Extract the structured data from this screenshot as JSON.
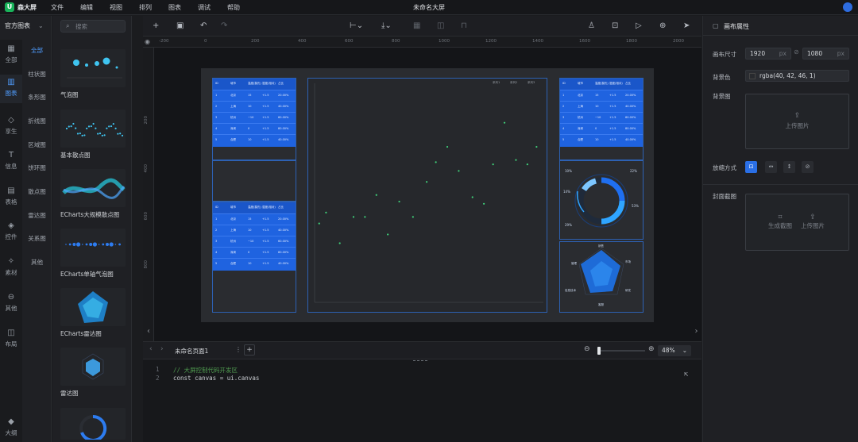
{
  "app": {
    "brand": "森大屏",
    "doc_title": "未命名大屏"
  },
  "menu": [
    "文件",
    "编辑",
    "视图",
    "排列",
    "图表",
    "调试",
    "帮助"
  ],
  "left": {
    "header": "官方图表",
    "rail": [
      {
        "label": "全部",
        "icon": "grid-icon"
      },
      {
        "label": "图表",
        "icon": "bar-chart-icon"
      },
      {
        "label": "享生",
        "icon": "diamond-icon"
      },
      {
        "label": "信息",
        "icon": "text-icon"
      },
      {
        "label": "表格",
        "icon": "table-icon"
      },
      {
        "label": "控件",
        "icon": "control-icon"
      },
      {
        "label": "素材",
        "icon": "asset-icon"
      },
      {
        "label": "其他",
        "icon": "more-icon"
      },
      {
        "label": "布局",
        "icon": "layout-icon"
      },
      {
        "label": "大纲",
        "icon": "layers-icon"
      }
    ],
    "subcats": [
      "全部",
      "柱状图",
      "条形图",
      "折线图",
      "区域图",
      "饼环图",
      "散点图",
      "雷达图",
      "关系图",
      "其他"
    ],
    "search_placeholder": "搜索",
    "cards": [
      "气泡图",
      "基本散点图",
      "ECharts大规模散点图",
      "ECharts单轴气泡图",
      "ECharts雷达图",
      "雷达图"
    ]
  },
  "toolbar": {
    "zoom": "48%"
  },
  "ruler": {
    "top": [
      "-200",
      "0",
      "200",
      "400",
      "600",
      "800",
      "1000",
      "1200",
      "1400",
      "1600",
      "1800",
      "2000",
      "2200"
    ],
    "left": [
      "200",
      "400",
      "600",
      "800"
    ]
  },
  "stage": {
    "table_header": [
      "ID",
      "城市",
      "温度(摄氏)",
      "湿度(相对)",
      "占比"
    ],
    "table_rows": [
      [
        "1",
        "北京",
        "15",
        "+1.5",
        "20.00%"
      ],
      [
        "2",
        "上海",
        "10",
        "+1.5",
        "40.00%"
      ],
      [
        "3",
        "杭州",
        "−10",
        "+1.5",
        "60.00%"
      ],
      [
        "4",
        "深圳",
        "0",
        "+1.5",
        "80.00%"
      ],
      [
        "5",
        "合肥",
        "10",
        "+1.5",
        "40.00%"
      ]
    ],
    "donut_labels": [
      "10%",
      "22%",
      "14%",
      "53%",
      "29%"
    ],
    "radar_labels": [
      "销售",
      "市场",
      "研发",
      "客服",
      "信息技术",
      "管理"
    ],
    "scatter_legend": [
      "系列1",
      "系列2",
      "系列3"
    ]
  },
  "chart_data": {
    "type": "scatter",
    "ylim": [
      0,
      1
    ],
    "points": [
      [
        0.02,
        0.36
      ],
      [
        0.05,
        0.41
      ],
      [
        0.11,
        0.27
      ],
      [
        0.17,
        0.39
      ],
      [
        0.22,
        0.39
      ],
      [
        0.27,
        0.49
      ],
      [
        0.32,
        0.31
      ],
      [
        0.37,
        0.46
      ],
      [
        0.43,
        0.39
      ],
      [
        0.49,
        0.55
      ],
      [
        0.53,
        0.64
      ],
      [
        0.58,
        0.71
      ],
      [
        0.63,
        0.6
      ],
      [
        0.69,
        0.48
      ],
      [
        0.74,
        0.45
      ],
      [
        0.78,
        0.63
      ],
      [
        0.83,
        0.82
      ],
      [
        0.88,
        0.65
      ],
      [
        0.93,
        0.63
      ],
      [
        0.97,
        0.71
      ]
    ]
  },
  "pagebar": {
    "page_name": "未命名页面1"
  },
  "code": [
    {
      "num": "1",
      "text": "// 大屏控制代码开发区"
    },
    {
      "num": "2",
      "text": "const canvas = ui.canvas"
    }
  ],
  "right": {
    "title": "画布属性",
    "size_label": "画布尺寸",
    "width": "1920",
    "height": "1080",
    "unit": "px",
    "bgcolor_label": "背景色",
    "bgcolor": "rgba(40, 42, 46, 1)",
    "bgimage_label": "背景图",
    "upload": "上传图片",
    "fit_label": "放缩方式",
    "cover_label": "封面截图",
    "screenshot": "生成截图"
  },
  "colors": {
    "accent": "#2a6fe6",
    "panel_blue": "#1f63e0",
    "scatter_green": "#3fd17a",
    "radar_blue": "#1e6fe0"
  }
}
